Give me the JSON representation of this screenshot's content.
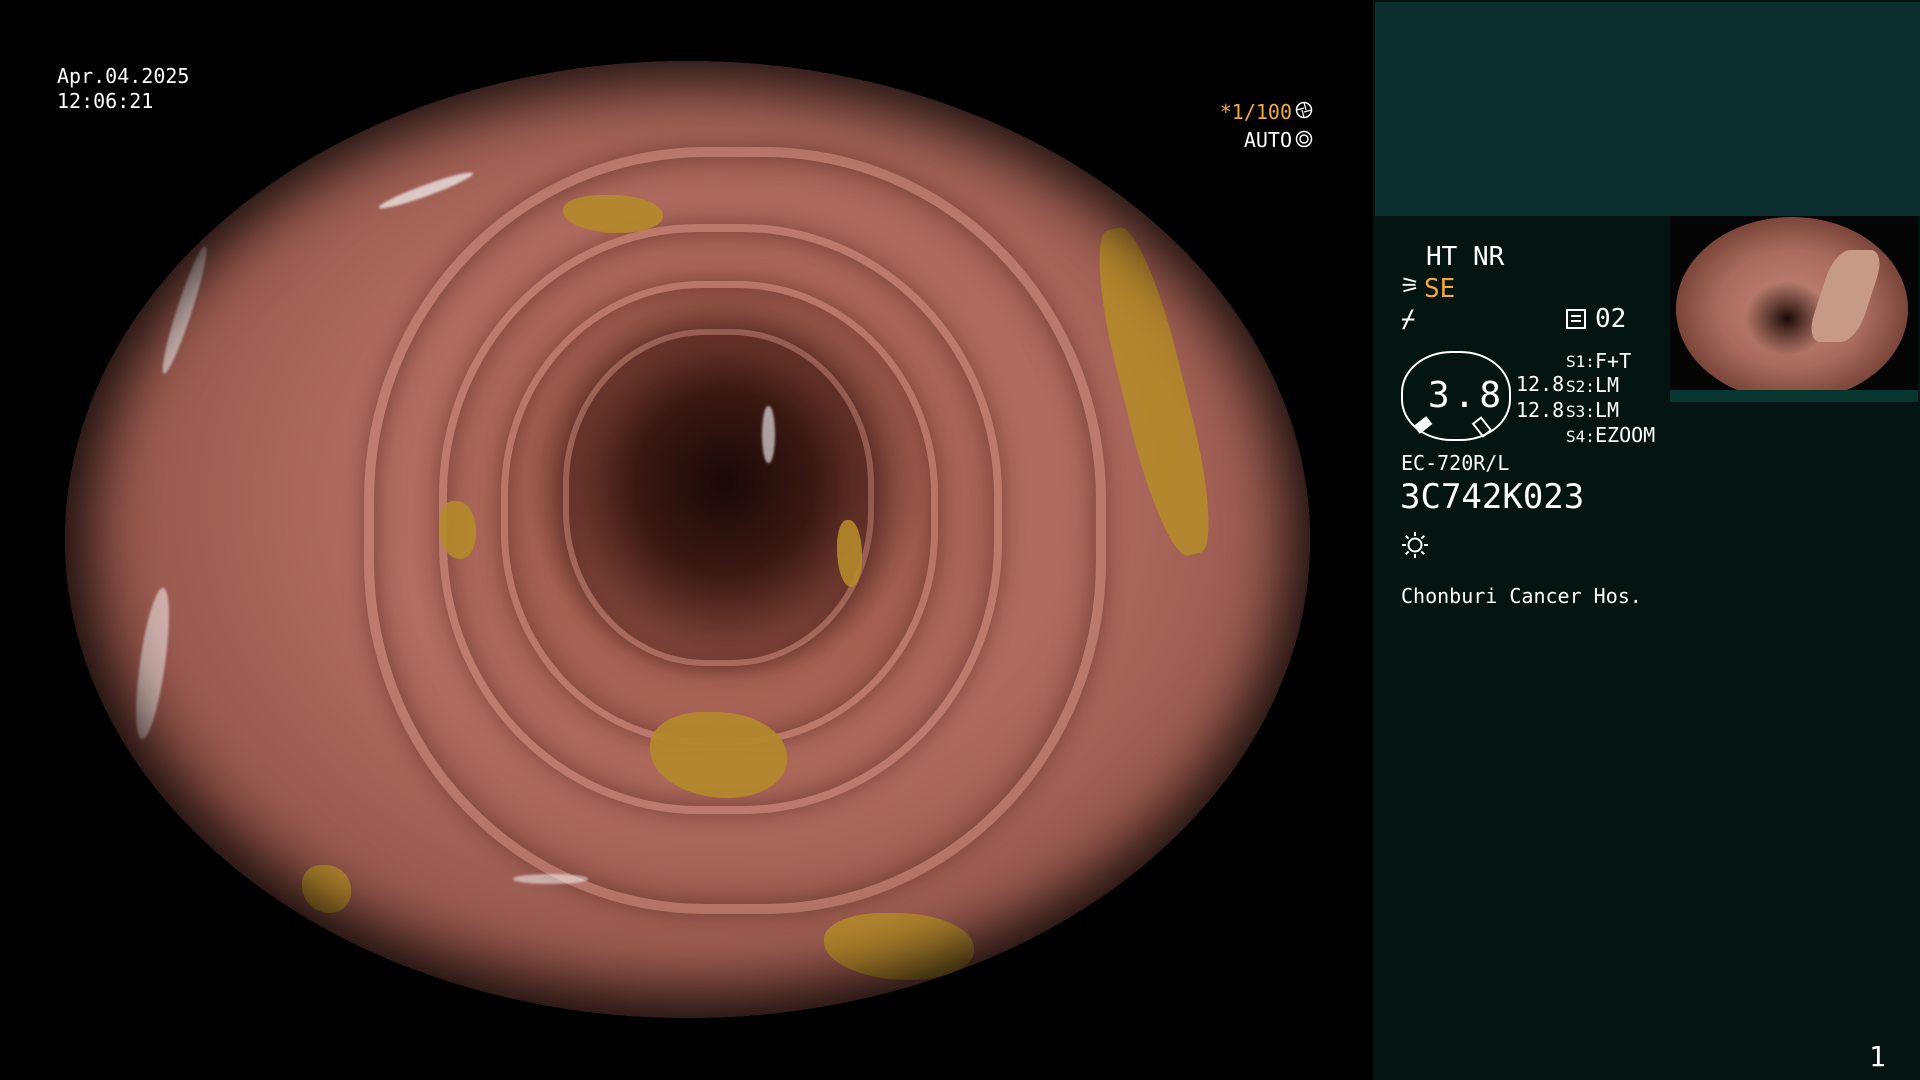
{
  "overlay": {
    "date": "Apr.04.2025",
    "time": "12:06:21",
    "shutter": "*1/100",
    "shutter_icon": "shutter-icon",
    "iris": "AUTO",
    "iris_icon": "iris-icon",
    "text_color": "#ffffff",
    "accent_color": "#f2a93b"
  },
  "side_panel": {
    "background": "#031411",
    "header_background": "#0a2f2e",
    "mode_line": "HT NR",
    "structure_enhance": "SE",
    "structure_enhance_icon": "se-icon",
    "enhance_icon": "enhance-icon",
    "mode_icon": "mode-icon",
    "mode_number": "02",
    "gauge_value": "3.8",
    "value_top": "12.8",
    "value_bottom": "12.8",
    "switches": [
      {
        "key": "S1:",
        "value": "F+T"
      },
      {
        "key": "S2:",
        "value": "LM"
      },
      {
        "key": "S3:",
        "value": "LM"
      },
      {
        "key": "S4:",
        "value": "EZOOM"
      }
    ],
    "scope_model": "EC-720R/L",
    "scope_serial": "3C742K023",
    "light_icon": "sun-icon",
    "hospital": "Chonburi Cancer Hos.",
    "image_count": "1"
  }
}
